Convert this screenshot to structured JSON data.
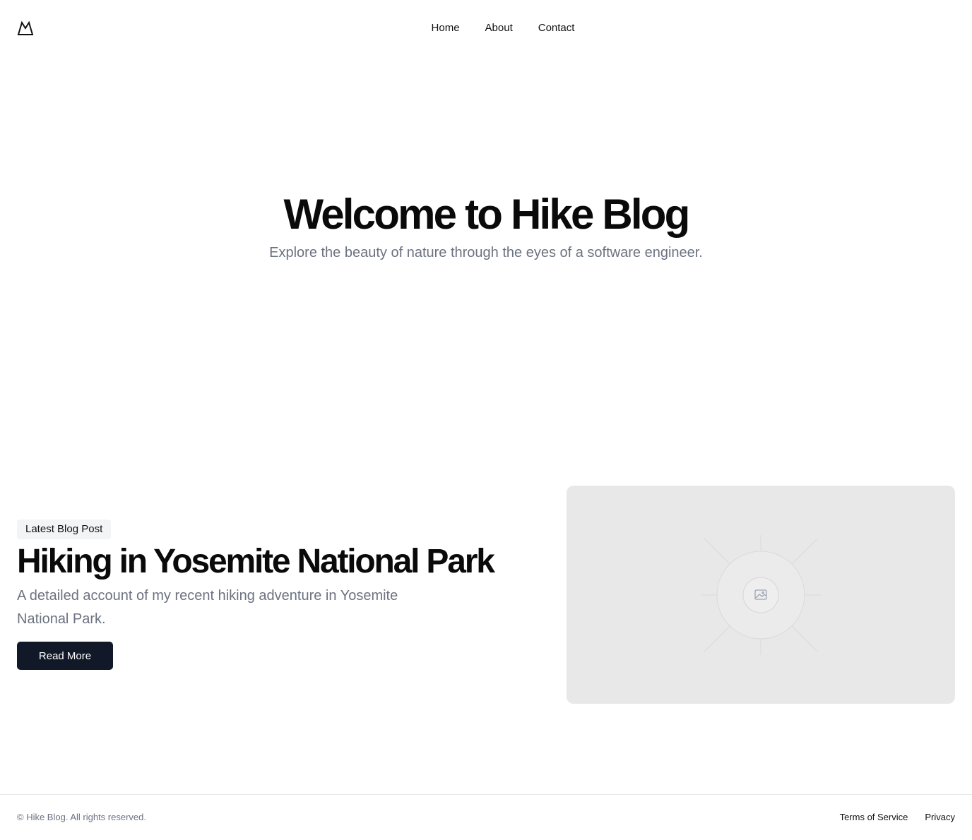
{
  "header": {
    "logo_icon": "mountain-icon",
    "nav": [
      {
        "label": "Home"
      },
      {
        "label": "About"
      },
      {
        "label": "Contact"
      }
    ]
  },
  "hero": {
    "title": "Welcome to Hike Blog",
    "subtitle": "Explore the beauty of nature through the eyes of a software engineer."
  },
  "featured": {
    "badge": "Latest Blog Post",
    "title": "Hiking in Yosemite National Park",
    "description": "A detailed account of my recent hiking adventure in Yosemite National Park.",
    "button_label": "Read More",
    "image_icon": "image-placeholder-icon"
  },
  "footer": {
    "copyright": "© Hike Blog. All rights reserved.",
    "links": [
      {
        "label": "Terms of Service"
      },
      {
        "label": "Privacy"
      }
    ]
  },
  "colors": {
    "primary_button": "#111827",
    "muted_text": "#6b7280",
    "badge_bg": "#f3f4f6",
    "placeholder_bg": "#e8e8e8"
  }
}
